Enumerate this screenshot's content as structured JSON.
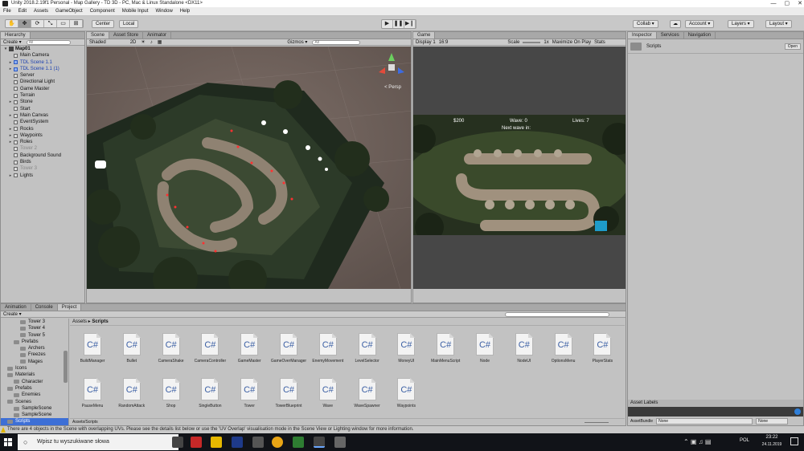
{
  "window": {
    "title": "Unity 2018.2.19f1 Personal - Map Gallery - TD 3D - PC, Mac & Linux Standalone <DX11>",
    "min": "—",
    "max": "▢",
    "close": "✕"
  },
  "menu": [
    "File",
    "Edit",
    "Assets",
    "GameObject",
    "Component",
    "Mobile Input",
    "Window",
    "Help"
  ],
  "toolbar": {
    "pivot_label": "Center",
    "space_label": "Local",
    "collab_label": "Collab ▾",
    "account_label": "Account ▾",
    "layers_label": "Layers ▾",
    "layout_label": "Layout ▾"
  },
  "hierarchy": {
    "tab": "Hierarchy",
    "create_label": "Create ▾",
    "search_placeholder": "All",
    "scene_name": "Map01",
    "items": [
      {
        "label": "Main Camera",
        "style": "normal",
        "arrow": ""
      },
      {
        "label": "TDL Scene 1.1",
        "style": "prefab",
        "arrow": "▸"
      },
      {
        "label": "TDL Scene 1.1 (1)",
        "style": "prefab",
        "arrow": "▸"
      },
      {
        "label": "Server",
        "style": "normal",
        "arrow": ""
      },
      {
        "label": "Directional Light",
        "style": "normal",
        "arrow": ""
      },
      {
        "label": "Game Master",
        "style": "normal",
        "arrow": ""
      },
      {
        "label": "Terrain",
        "style": "normal",
        "arrow": ""
      },
      {
        "label": "Stone",
        "style": "normal",
        "arrow": "▸"
      },
      {
        "label": "Start",
        "style": "normal",
        "arrow": ""
      },
      {
        "label": "Main Canvas",
        "style": "normal",
        "arrow": "▸"
      },
      {
        "label": "EventSystem",
        "style": "normal",
        "arrow": ""
      },
      {
        "label": "Rocks",
        "style": "normal",
        "arrow": "▸"
      },
      {
        "label": "Waypoints",
        "style": "normal",
        "arrow": "▸"
      },
      {
        "label": "Roles",
        "style": "normal",
        "arrow": "▸"
      },
      {
        "label": "Tower 2",
        "style": "dim",
        "arrow": ""
      },
      {
        "label": "Background Sound",
        "style": "normal",
        "arrow": ""
      },
      {
        "label": "Birds",
        "style": "normal",
        "arrow": ""
      },
      {
        "label": "Tower 3",
        "style": "dim",
        "arrow": ""
      },
      {
        "label": "Lights",
        "style": "normal",
        "arrow": "▸"
      }
    ]
  },
  "scene": {
    "tabs": [
      "Scene",
      "Asset Store",
      "Animator"
    ],
    "shading_mode": "Shaded",
    "gizmos_label": "Gizmos ▾",
    "search_placeholder": "All",
    "persp_label": "< Persp"
  },
  "game": {
    "tab": "Game",
    "display_label": "Display 1",
    "aspect_label": "16:9",
    "scale_label": "Scale",
    "scale_value": "1x",
    "maximize_label": "Maximize On Play",
    "stats_label": "Stats",
    "hud": {
      "money": "$200",
      "wave": "Wave: 0",
      "next_wave": "Next wave in:",
      "lives": "Lives: 7"
    }
  },
  "inspector": {
    "tabs": [
      "Inspector",
      "Services",
      "Navigation"
    ],
    "object_name": "Scripts",
    "open_label": "Open",
    "asset_labels": "Asset Labels",
    "assetbundle_label": "AssetBundle",
    "assetbundle_value": "None",
    "variant_value": "None"
  },
  "bottom": {
    "tabs": [
      "Animation",
      "Console",
      "Project"
    ],
    "create_label": "Create ▾",
    "breadcrumb": [
      "Assets",
      "Scripts"
    ],
    "path_footer": "Assets/Scripts",
    "tree": [
      {
        "label": "Tower 3",
        "indent": 3
      },
      {
        "label": "Tower 4",
        "indent": 3
      },
      {
        "label": "Tower 5",
        "indent": 3
      },
      {
        "label": "Prefabs",
        "indent": 2
      },
      {
        "label": "Archers",
        "indent": 3
      },
      {
        "label": "Freezes",
        "indent": 3
      },
      {
        "label": "Mages",
        "indent": 3
      },
      {
        "label": "Icons",
        "indent": 1
      },
      {
        "label": "Materials",
        "indent": 1
      },
      {
        "label": "Character",
        "indent": 2
      },
      {
        "label": "Prefabs",
        "indent": 1
      },
      {
        "label": "Enemies",
        "indent": 2
      },
      {
        "label": "Scenes",
        "indent": 1
      },
      {
        "label": "SampleScene",
        "indent": 2
      },
      {
        "label": "SampleScene",
        "indent": 2
      },
      {
        "label": "Scripts",
        "indent": 1
      }
    ],
    "assets_row1": [
      "BuildManager",
      "Bullet",
      "CameraShake",
      "CameraController",
      "GameMaster",
      "GameOverManager",
      "EnemyMovement",
      "LevelSelector",
      "MoneyUI",
      "MainMenuScript",
      "Node",
      "NodeUI",
      "OptionsMenu",
      "PlayerStats"
    ],
    "assets_row2": [
      "PauseMenu",
      "RandomAttack",
      "Shop",
      "SingleButton",
      "Tower",
      "TowerBlueprint",
      "Wave",
      "WaveSpawner",
      "Waypoints"
    ]
  },
  "status_message": "There are 4 objects in the Scene with overlapping UVs. Please see the details list below or use the 'UV Overlap' visualisation mode in the Scene View or Lighting window for more information.",
  "taskbar": {
    "search_placeholder": "Wpisz tu wyszukiwane słowa",
    "lang": "POL",
    "time": "23:22",
    "date": "24.11.2019"
  },
  "colors": {
    "panel_bg": "#c2c2c2",
    "toolbar_bg": "#c8c8c8",
    "taskbar_bg": "#111318",
    "hud_button": "#1e9bc9"
  }
}
